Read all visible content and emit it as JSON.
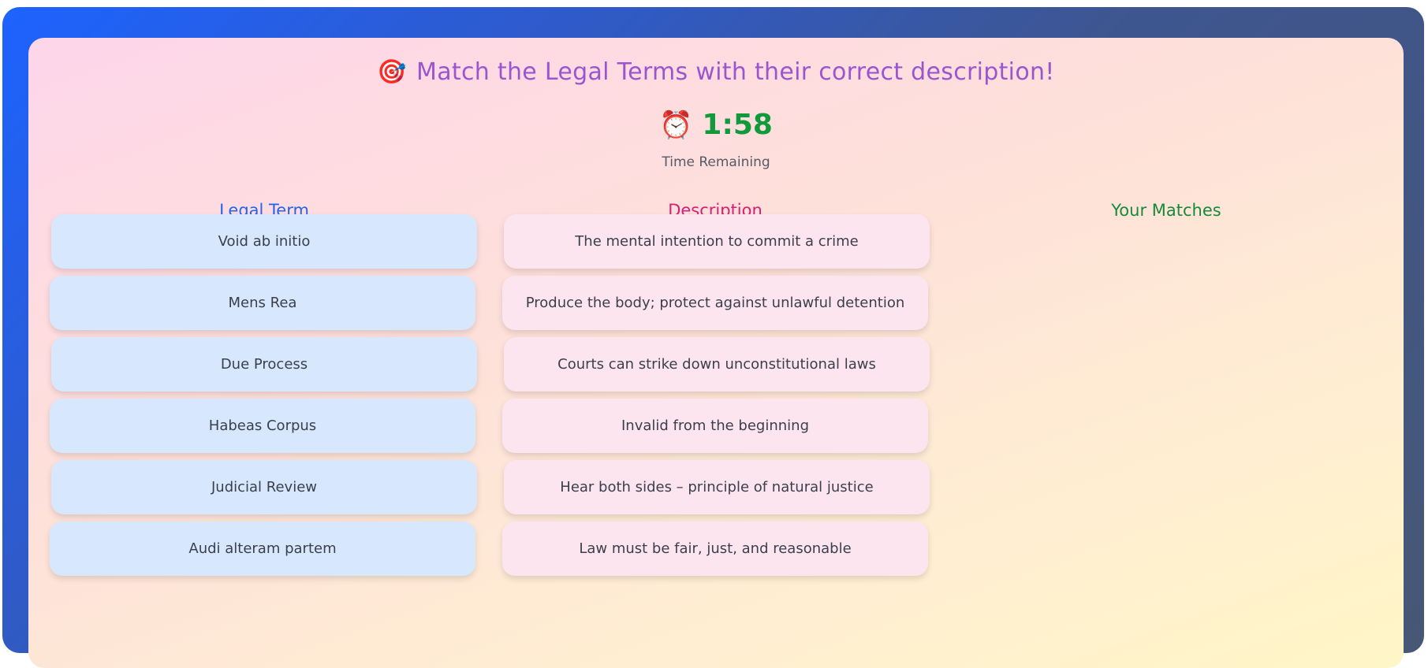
{
  "header": {
    "title_icon": "target-icon",
    "title": "Match the Legal Terms with their correct description!"
  },
  "timer": {
    "icon": "alarm-clock-icon",
    "value": "1:58",
    "label": "Time Remaining"
  },
  "columns": {
    "terms_header": "Legal Term",
    "descriptions_header": "Description",
    "matches_header": "Your Matches"
  },
  "terms": [
    "Void ab initio",
    "Mens Rea",
    "Due Process",
    "Habeas Corpus",
    "Judicial Review",
    "Audi alteram partem"
  ],
  "descriptions": [
    "The mental intention to commit a crime",
    "Produce the body; protect against unlawful detention",
    "Courts can strike down unconstitutional laws",
    "Invalid from the beginning",
    "Hear both sides – principle of natural justice",
    "Law must be fair, just, and reasonable"
  ],
  "colors": {
    "title": "#9a55cf",
    "timer": "#119a3c",
    "terms_header": "#2465e8",
    "descriptions_header": "#d81e74",
    "matches_header": "#168a3c",
    "term_tile": "#d7e8fe",
    "description_tile": "#fde5f0"
  }
}
